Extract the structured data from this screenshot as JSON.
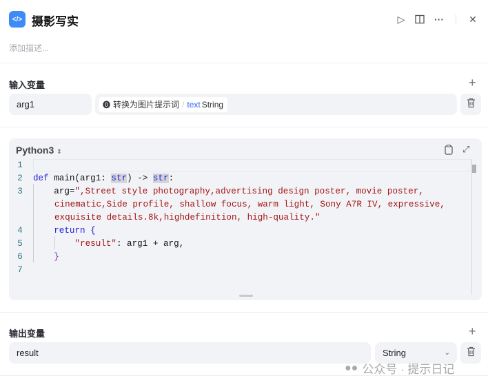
{
  "header": {
    "title": "摄影写实",
    "description_placeholder": "添加描述...",
    "icons": [
      "code-icon",
      "play-icon",
      "book-icon",
      "more-icon",
      "close-icon"
    ]
  },
  "input": {
    "label": "输入变量",
    "rows": [
      {
        "name": "arg1",
        "source_node": "转换为图片提示词",
        "separator": "/",
        "field": "text",
        "type": "String"
      }
    ]
  },
  "code": {
    "language": "Python3",
    "line_numbers": [
      "1",
      "2",
      "3",
      "4",
      "5",
      "6",
      "7"
    ],
    "lines": {
      "l2a": "def",
      "l2b": " main(arg1: ",
      "l2c": "str",
      "l2d": ") -> ",
      "l2e": "str",
      "l2f": ":",
      "l3a": "    arg=",
      "l3b": "\",Street style photography,advertising design poster, movie poster,",
      "l3c": "cinematic,Side profile, shallow focus, warm light, Sony A7R IV, expressive,",
      "l3d": "exquisite details.8k,highdefinition, high-quality.\"",
      "l4a": "    return ",
      "l4b": "{",
      "l5a": "        ",
      "l5b": "\"result\"",
      "l5c": ": arg1 + arg,",
      "l6": "    }"
    }
  },
  "output": {
    "label": "输出变量",
    "rows": [
      {
        "name": "result",
        "type": "String"
      }
    ]
  },
  "watermark": "公众号 · 提示日记"
}
